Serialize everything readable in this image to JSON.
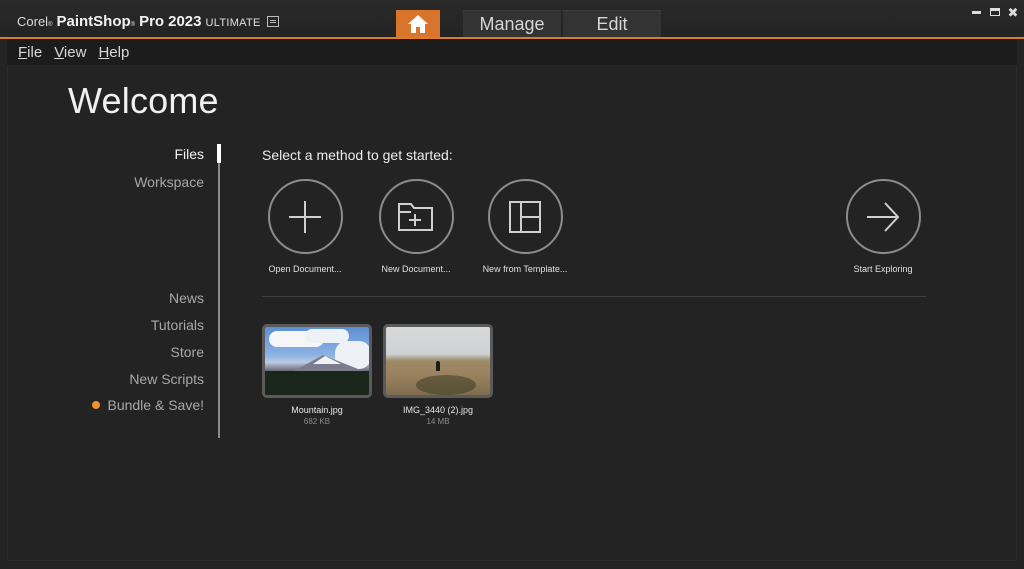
{
  "app": {
    "brand": "Corel",
    "product": "PaintShop",
    "product_suffix": "Pro",
    "version": "2023",
    "edition": "ULTIMATE",
    "registered_mark": "®"
  },
  "tabs": [
    {
      "id": "home",
      "label": "",
      "icon": "home-icon",
      "active": true
    },
    {
      "id": "manage",
      "label": "Manage",
      "active": false
    },
    {
      "id": "edit",
      "label": "Edit",
      "active": false
    }
  ],
  "window_controls": {
    "minimize_icon": "minimize-icon",
    "maximize_icon": "maximize-icon",
    "close_icon": "close-icon",
    "close_glyph": "✖"
  },
  "menu": [
    {
      "label": "File",
      "mnemonic": "F",
      "rest": "ile"
    },
    {
      "label": "View",
      "mnemonic": "V",
      "rest": "iew"
    },
    {
      "label": "Help",
      "mnemonic": "H",
      "rest": "elp"
    }
  ],
  "page": {
    "title": "Welcome"
  },
  "sidenav": {
    "items": [
      {
        "label": "Files",
        "active": true
      },
      {
        "label": "Workspace",
        "active": false
      },
      {
        "label": "News",
        "active": false
      },
      {
        "label": "Tutorials",
        "active": false
      },
      {
        "label": "Store",
        "active": false
      },
      {
        "label": "New Scripts",
        "active": false
      },
      {
        "label": "Bundle & Save!",
        "active": false,
        "dot": true
      }
    ],
    "dot_color": "#f0932b"
  },
  "main": {
    "prompt": "Select a method to get started:",
    "actions": [
      {
        "label": "Open Document...",
        "icon": "plus-icon"
      },
      {
        "label": "New Document...",
        "icon": "folder-plus-icon"
      },
      {
        "label": "New from Template...",
        "icon": "template-layout-icon"
      },
      {
        "label": "Start Exploring",
        "icon": "arrow-right-icon"
      }
    ],
    "recent_files": [
      {
        "name": "Mountain.jpg",
        "size": "682 KB"
      },
      {
        "name": "IMG_3440 (2).jpg",
        "size": "14 MB"
      }
    ]
  },
  "colors": {
    "accent": "#d9742b",
    "background": "#232323",
    "menubar": "#1c1c1c"
  }
}
